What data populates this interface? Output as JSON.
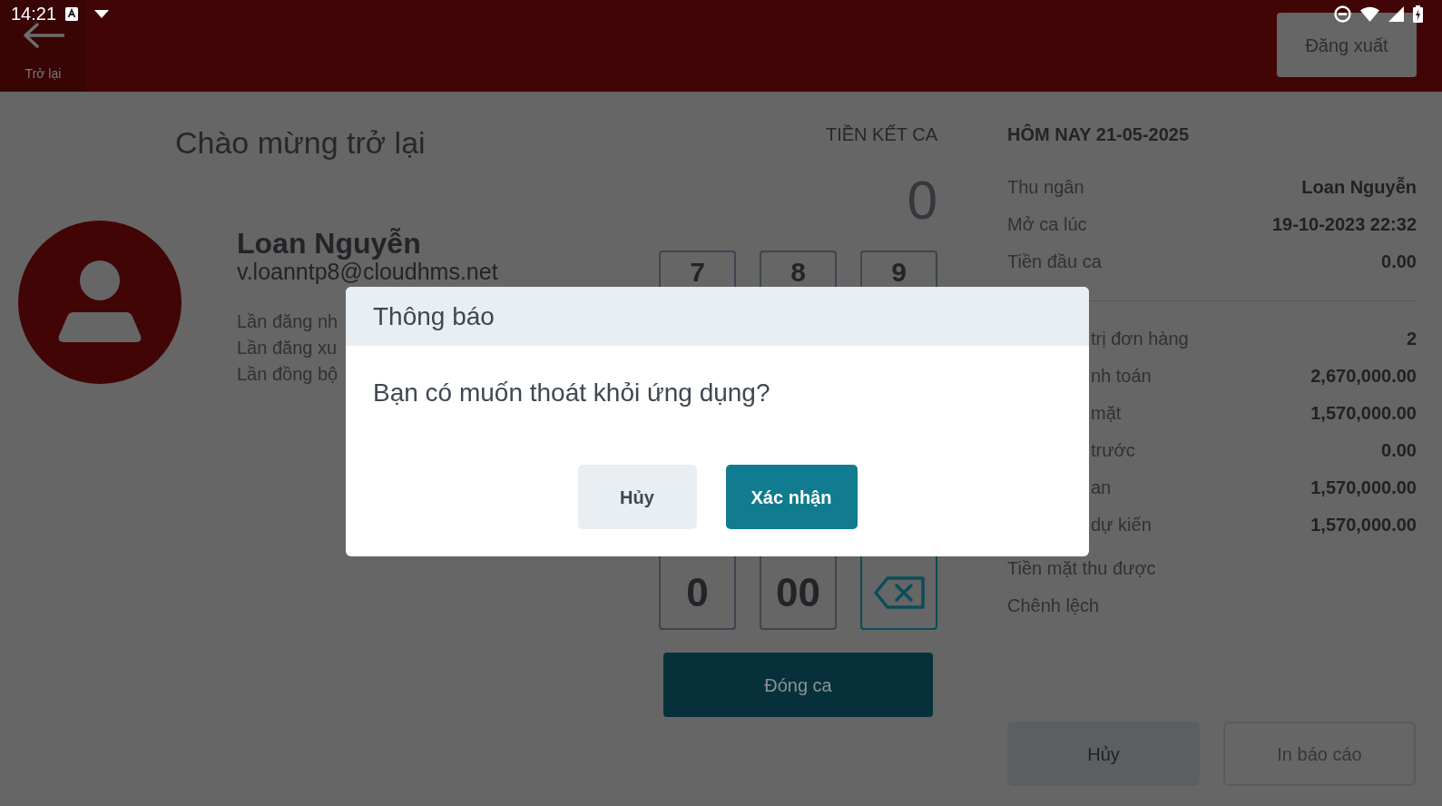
{
  "status_bar": {
    "time": "14:21"
  },
  "app_bar": {
    "back_label": "Trở lại",
    "logout_button": "Đăng xuất"
  },
  "welcome": {
    "title": "Chào mừng trở lại",
    "user_name": "Loan Nguyễn",
    "email": "v.loanntp8@cloudhms.net",
    "details": [
      "Lần đăng nh",
      "Lần đăng xu",
      "Lần đồng bộ"
    ]
  },
  "closing_cash": {
    "title": "TIỀN KẾT CA",
    "amount": "0",
    "top_keys": [
      "7",
      "8",
      "9"
    ],
    "bottom_keys": [
      {
        "kind": "digit",
        "label": "0"
      },
      {
        "kind": "digit",
        "label": "00"
      },
      {
        "kind": "backspace"
      }
    ],
    "close_button": "Đóng ca"
  },
  "summary": {
    "title": "HÔM NAY 21-05-2025",
    "shift_rows": [
      {
        "label": "Thu ngân",
        "value": "Loan Nguyễn"
      },
      {
        "label": "Mở ca lúc",
        "value": "19-10-2023 22:32"
      },
      {
        "label": "Tiền đầu ca",
        "value": "0.00"
      }
    ],
    "total_rows": [
      {
        "label": "trị đơn hàng",
        "value": "2"
      },
      {
        "label": "nh toán",
        "value": "2,670,000.00"
      },
      {
        "label": "mặt",
        "value": "1,570,000.00"
      },
      {
        "label": "trước",
        "value": "0.00"
      },
      {
        "label": "an",
        "value": "1,570,000.00"
      },
      {
        "label": "dự kiến",
        "value": "1,570,000.00"
      },
      {
        "label": "Tiền mặt thu được"
      },
      {
        "label": "Chênh lệch"
      }
    ],
    "buttons": [
      {
        "label": "Hủy",
        "disabled": false
      },
      {
        "label": "In báo cáo",
        "disabled": true
      }
    ]
  },
  "dialog": {
    "title": "Thông báo",
    "message": "Bạn có muốn thoát khỏi ứng dụng?",
    "buttons": [
      {
        "label": "Hủy",
        "kind": "secondary"
      },
      {
        "label": "Xác nhận",
        "kind": "primary"
      }
    ]
  }
}
